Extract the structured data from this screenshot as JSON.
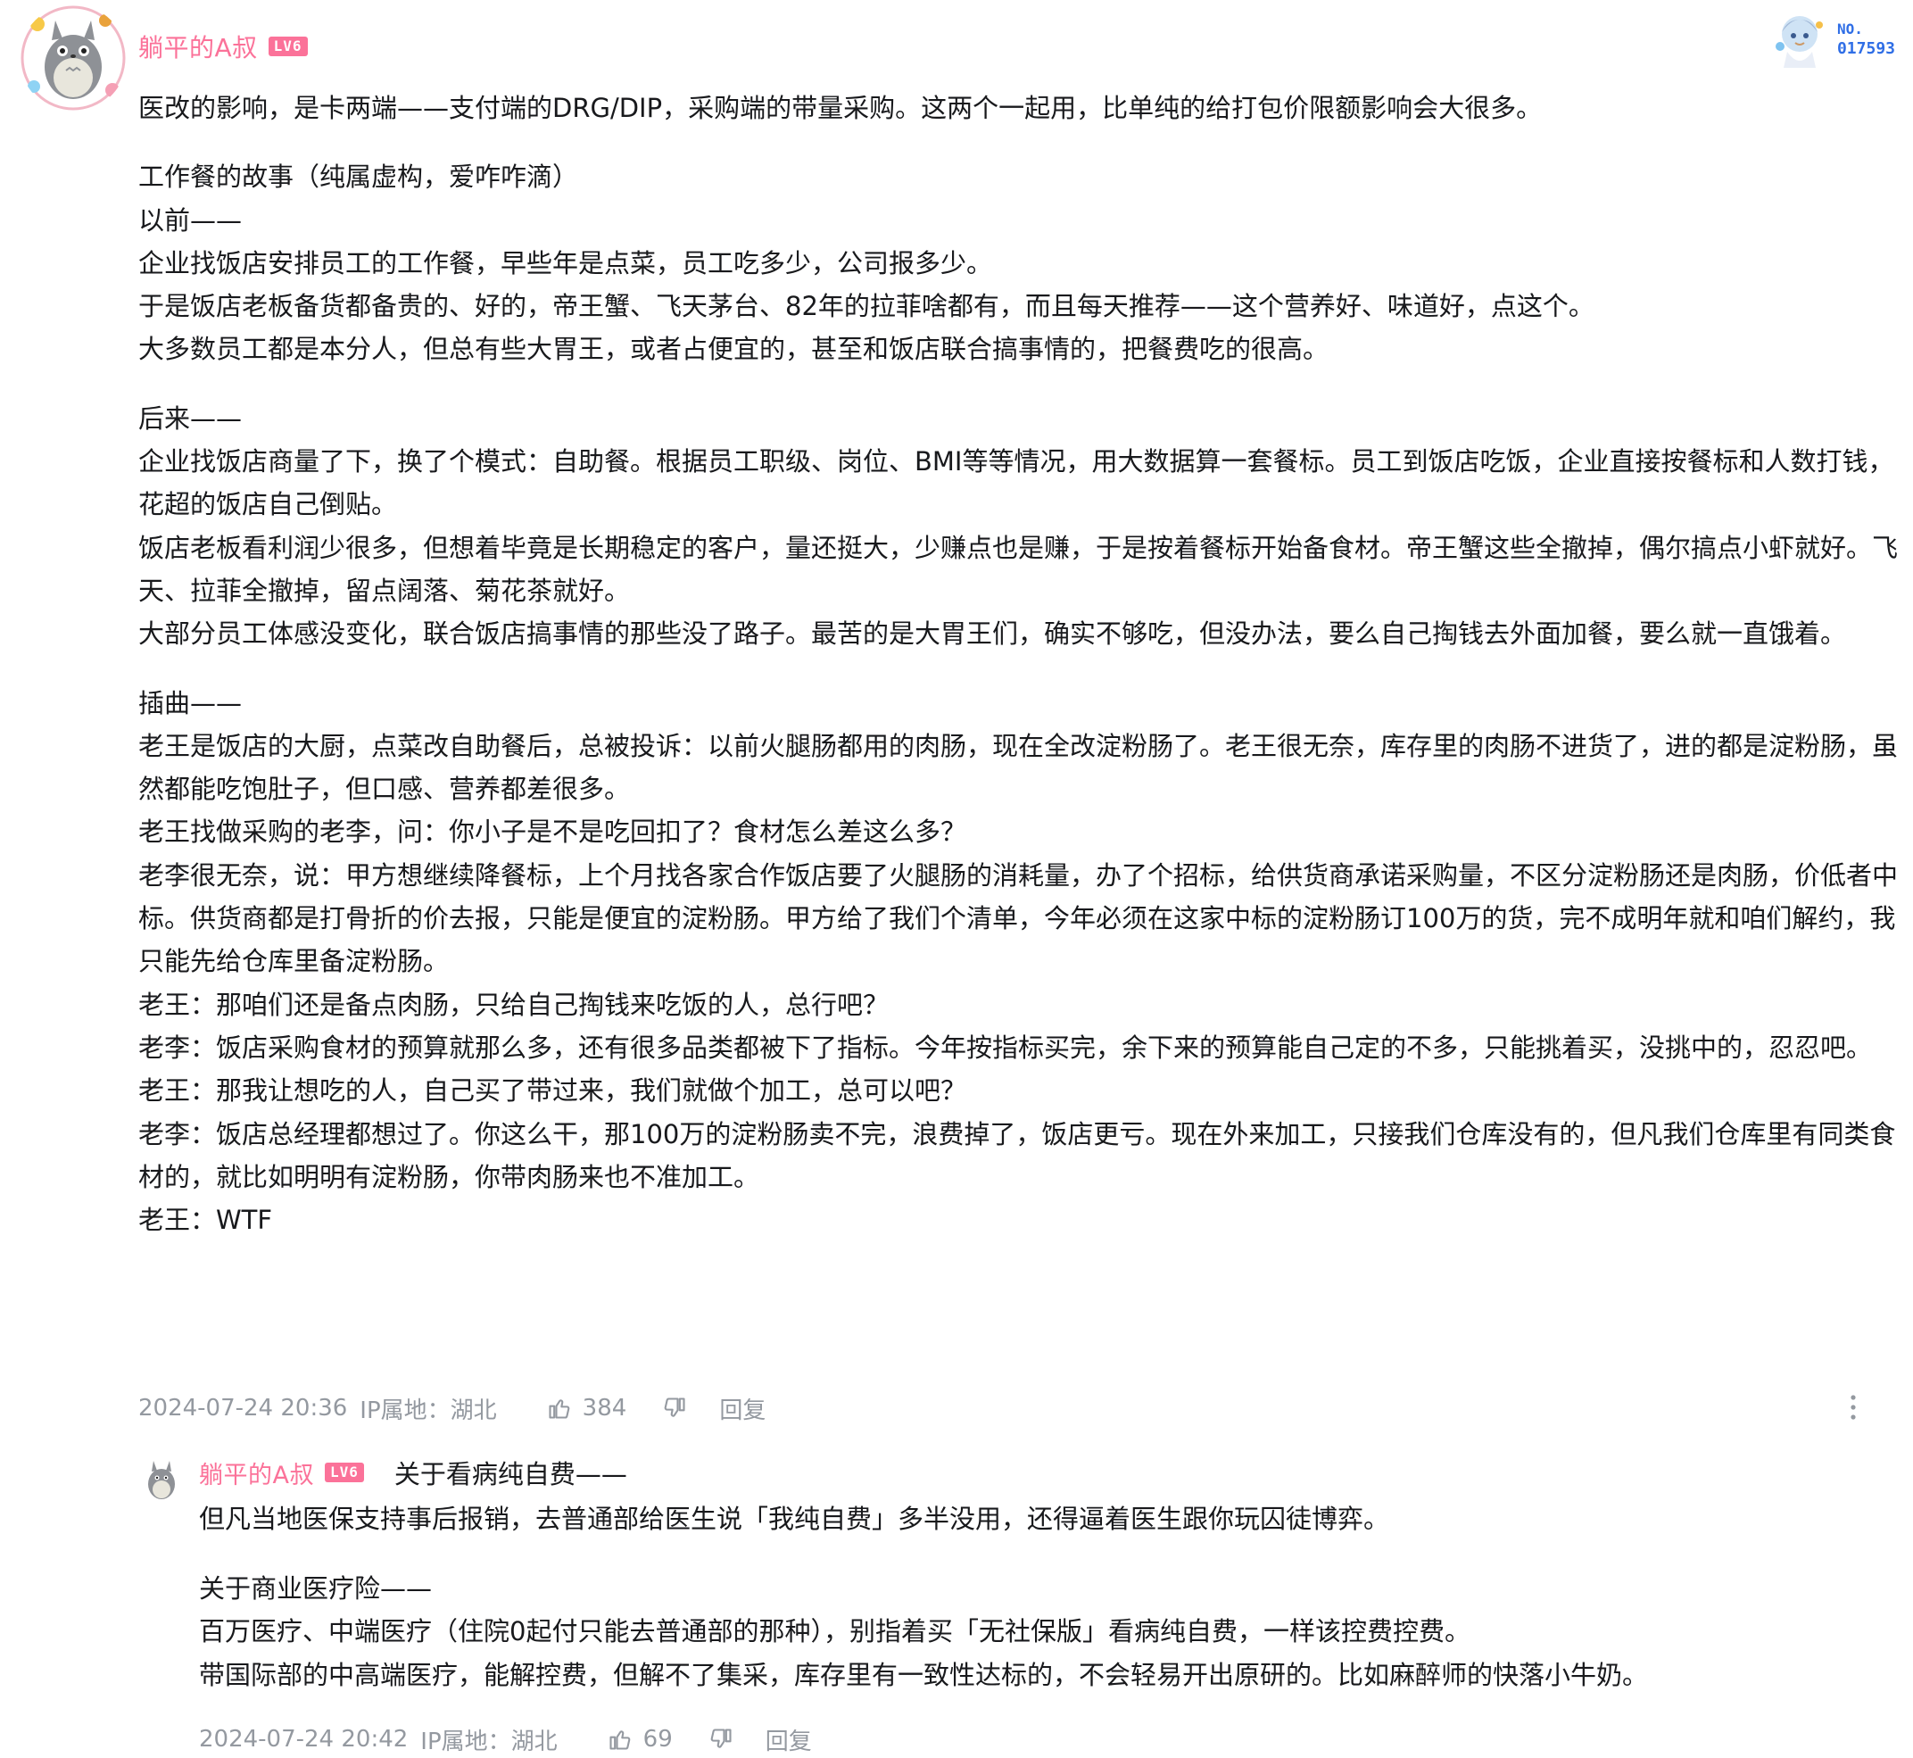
{
  "comment": {
    "username": "躺平的A叔",
    "level": "LV6",
    "fan_badge": {
      "label": "NO.",
      "number": "017593"
    },
    "paragraphs": [
      "医改的影响，是卡两端——支付端的DRG/DIP，采购端的带量采购。这两个一起用，比单纯的给打包价限额影响会大很多。",
      "",
      "工作餐的故事（纯属虚构，爱咋咋滴）",
      "以前——",
      "企业找饭店安排员工的工作餐，早些年是点菜，员工吃多少，公司报多少。",
      "于是饭店老板备货都备贵的、好的，帝王蟹、飞天茅台、82年的拉菲啥都有，而且每天推荐——这个营养好、味道好，点这个。",
      "大多数员工都是本分人，但总有些大胃王，或者占便宜的，甚至和饭店联合搞事情的，把餐费吃的很高。",
      "",
      "后来——",
      "企业找饭店商量了下，换了个模式：自助餐。根据员工职级、岗位、BMI等等情况，用大数据算一套餐标。员工到饭店吃饭，企业直接按餐标和人数打钱，花超的饭店自己倒贴。",
      "饭店老板看利润少很多，但想着毕竟是长期稳定的客户，量还挺大，少赚点也是赚，于是按着餐标开始备食材。帝王蟹这些全撤掉，偶尔搞点小虾就好。飞天、拉菲全撤掉，留点阔落、菊花茶就好。",
      "大部分员工体感没变化，联合饭店搞事情的那些没了路子。最苦的是大胃王们，确实不够吃，但没办法，要么自己掏钱去外面加餐，要么就一直饿着。",
      "",
      "插曲——",
      "老王是饭店的大厨，点菜改自助餐后，总被投诉：以前火腿肠都用的肉肠，现在全改淀粉肠了。老王很无奈，库存里的肉肠不进货了，进的都是淀粉肠，虽然都能吃饱肚子，但口感、营养都差很多。",
      "老王找做采购的老李，问：你小子是不是吃回扣了？食材怎么差这么多？",
      "老李很无奈，说：甲方想继续降餐标，上个月找各家合作饭店要了火腿肠的消耗量，办了个招标，给供货商承诺采购量，不区分淀粉肠还是肉肠，价低者中标。供货商都是打骨折的价去报，只能是便宜的淀粉肠。甲方给了我们个清单，今年必须在这家中标的淀粉肠订100万的货，完不成明年就和咱们解约，我只能先给仓库里备淀粉肠。",
      "老王：那咱们还是备点肉肠，只给自己掏钱来吃饭的人，总行吧？",
      "老李：饭店采购食材的预算就那么多，还有很多品类都被下了指标。今年按指标买完，余下来的预算能自己定的不多，只能挑着买，没挑中的，忍忍吧。",
      "老王：那我让想吃的人，自己买了带过来，我们就做个加工，总可以吧？",
      "老李：饭店总经理都想过了。你这么干，那100万的淀粉肠卖不完，浪费掉了，饭店更亏。现在外来加工，只接我们仓库没有的，但凡我们仓库里有同类食材的，就比如明明有淀粉肠，你带肉肠来也不准加工。",
      "老王：WTF"
    ],
    "time": "2024-07-24 20:36",
    "ip_label": "IP属地：",
    "ip_location": "湖北",
    "likes": "384",
    "reply_label": "回复"
  },
  "reply": {
    "username": "躺平的A叔",
    "level": "LV6",
    "first_line": "关于看病纯自费——",
    "paragraphs": [
      "但凡当地医保支持事后报销，去普通部给医生说「我纯自费」多半没用，还得逼着医生跟你玩囚徒博弈。",
      "",
      "关于商业医疗险——",
      "百万医疗、中端医疗（住院0起付只能去普通部的那种），别指着买「无社保版」看病纯自费，一样该控费控费。",
      "带国际部的中高端医疗，能解控费，但解不了集采，库存里有一致性达标的，不会轻易开出原研的。比如麻醉师的快落小牛奶。"
    ],
    "time": "2024-07-24 20:42",
    "ip_label": "IP属地：",
    "ip_location": "湖北",
    "likes": "69",
    "reply_label": "回复"
  },
  "colors": {
    "username": "#fb7299",
    "meta_text": "#9499a0",
    "body_text": "#18191c",
    "fan_number": "#2f6ee6"
  },
  "icons": [
    "avatar-totoro-icon",
    "fan-badge-character-icon",
    "thumb-up-icon",
    "thumb-down-icon",
    "more-vertical-icon"
  ]
}
